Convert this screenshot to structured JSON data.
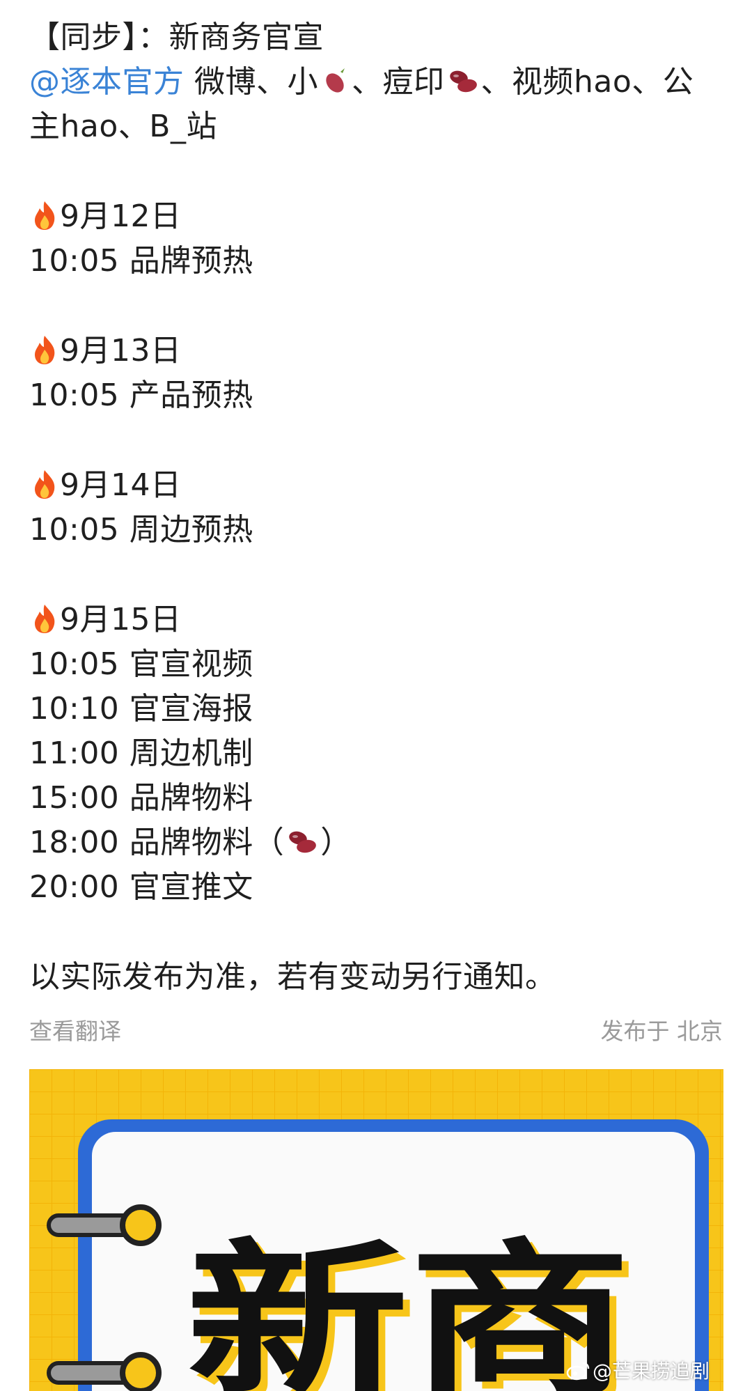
{
  "post": {
    "title": "【同步】：新商务官宣",
    "mention": "@逐本官方",
    "platforms_line1": {
      "a": " 微博、小",
      "b": "、痘印",
      "c": "、视频hao、公"
    },
    "platforms_line2": "主hao、B_站",
    "schedule": [
      {
        "date": "9月12日",
        "items": [
          "10:05 品牌预热"
        ]
      },
      {
        "date": "9月13日",
        "items": [
          "10:05 产品预热"
        ]
      },
      {
        "date": "9月14日",
        "items": [
          "10:05 周边预热"
        ]
      },
      {
        "date": "9月15日",
        "items": [
          "10:05 官宣视频",
          "10:10 官宣海报",
          "11:00 周边机制",
          "15:00 品牌物料"
        ],
        "item_with_emoji": {
          "before": "18:00 品牌物料（",
          "after": "）"
        },
        "last_item": "20:00 官宣推文"
      }
    ],
    "footer_note": "以实际发布为准，若有变动另行通知。"
  },
  "meta": {
    "translate_link": "查看翻译",
    "location": "发布于 北京"
  },
  "image": {
    "text": "新商",
    "colors": {
      "background": "#f7c51a",
      "frame": "#2d6ad6",
      "text": "#111111"
    }
  },
  "watermark": {
    "text": "@芒果捞追剧"
  },
  "icons": [
    "fire-emoji-icon",
    "sweet-potato-icon",
    "bean-icon",
    "weibo-logo-icon"
  ]
}
